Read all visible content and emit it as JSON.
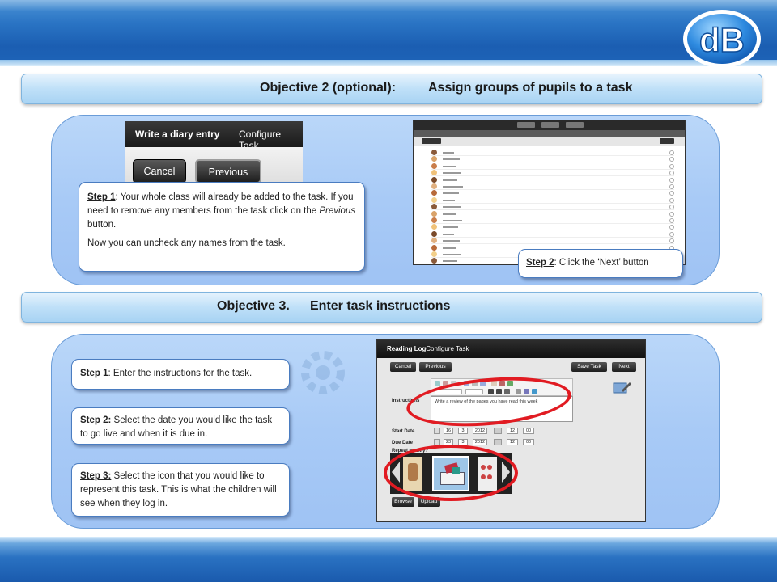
{
  "logo": {
    "text": "dB"
  },
  "objective2": {
    "label": "Objective 2 (optional):",
    "text": "Assign groups of pupils to a task"
  },
  "objective3": {
    "label": "Objective 3.",
    "text": "Enter task instructions"
  },
  "screenshot1": {
    "title_bold": "Write a diary entry",
    "title_rest": "Configure Task",
    "cancel": "Cancel",
    "previous": "Previous"
  },
  "step1_obj2": {
    "step": "Step 1",
    "text_a": ": Your whole class will already be added to the task. If you need to remove any members from the task click on the ",
    "text_em": "Previous",
    "text_b": " button.",
    "text2": "Now you can uncheck any names from the task."
  },
  "step2_obj2": {
    "step": "Step 2",
    "text": ": Click the ‘Next’ button"
  },
  "step1_obj3": {
    "step": "Step 1",
    "text": ": Enter the instructions for the task."
  },
  "step2_obj3": {
    "step": "Step 2:",
    "text": " Select the date you would like the task to go live and when it is due in."
  },
  "step3_obj3": {
    "step": "Step 3:",
    "text": " Select the icon that you would like to represent this task. This is what the children will see when they log in."
  },
  "screenshot3": {
    "title_bold": "Reading Log",
    "title_rest": " Configure Task",
    "cancel": "Cancel",
    "previous": "Previous",
    "save": "Save Task",
    "next": "Next",
    "instructions_label": "Instructions",
    "instructions_value": "Write a review of the pages you have read this week",
    "start_label": "Start Date",
    "due_label": "Due Date",
    "repeat_label": "Repeat weekly?",
    "start_day": "16",
    "start_month": "3",
    "start_year": "2012",
    "start_hour": "12",
    "start_min": "00",
    "due_day": "23",
    "due_month": "3",
    "due_year": "2012",
    "due_hour": "12",
    "due_min": "00",
    "browse": "Browse",
    "upload": "Upload"
  },
  "colors": {
    "accent_blue": "#1b5eb2",
    "panel_blue": "#a8caf6",
    "highlight_red": "#e11b22"
  }
}
